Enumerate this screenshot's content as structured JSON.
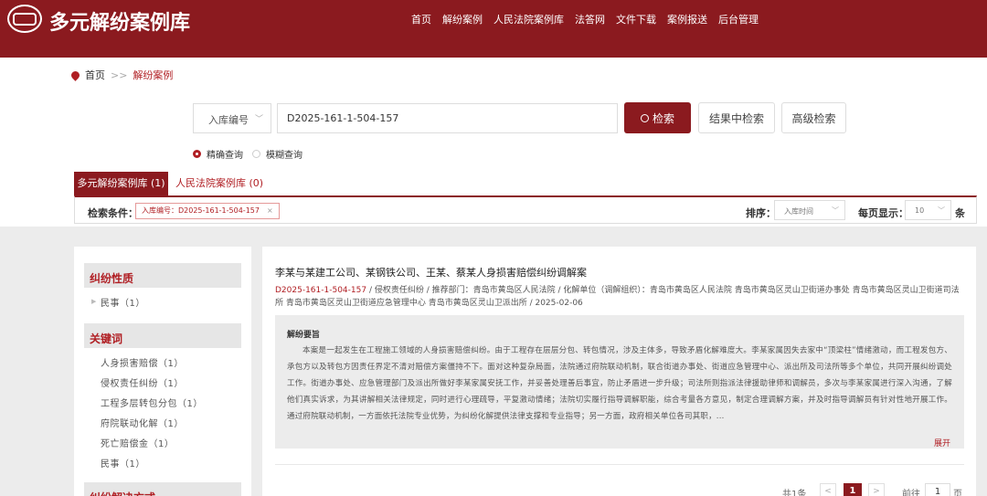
{
  "header": {
    "title": "多元解纷案例库",
    "nav": [
      "首页",
      "解纷案例",
      "人民法院案例库",
      "法答网",
      "文件下载",
      "案例报送",
      "后台管理"
    ]
  },
  "breadcrumb": {
    "home": "首页",
    "separator": ">>",
    "current": "解纷案例"
  },
  "search": {
    "field_label": "入库编号",
    "query": "D2025-161-1-504-157",
    "search_button": "检索",
    "within_button": "结果中检索",
    "advanced_button": "高级检索",
    "mode_exact": "精确查询",
    "mode_fuzzy": "模糊查询",
    "selected_mode": "exact"
  },
  "tabs": [
    {
      "label": "多元解纷案例库 (1)",
      "active": true
    },
    {
      "label": "人民法院案例库 (0)",
      "active": false
    }
  ],
  "conditions": {
    "label": "检索条件：",
    "tag": "入库编号：D2025-161-1-504-157",
    "tag_close": "×",
    "sort_label": "排序：",
    "sort_value": "入库时间",
    "per_page_label": "每页显示：",
    "per_page_value": "10",
    "per_page_unit": "条"
  },
  "sidebar": {
    "groups": [
      {
        "title": "纠纷性质",
        "items": [
          "民事（1）"
        ]
      },
      {
        "title": "关键词",
        "items": [
          "人身损害赔偿（1）",
          "侵权责任纠纷（1）",
          "工程多层转包分包（1）",
          "府院联动化解（1）",
          "死亡赔偿金（1）",
          "民事（1）"
        ]
      },
      {
        "title": "纠纷解决方式",
        "items": []
      }
    ]
  },
  "result": {
    "title": "李某与某建工公司、某钢铁公司、王某、蔡某人身损害赔偿纠纷调解案",
    "code": "D2025-161-1-504-157",
    "meta": " / 侵权责任纠纷 / 推荐部门：青岛市黄岛区人民法院 / 化解单位（调解组织）：青岛市黄岛区人民法院 青岛市黄岛区灵山卫街道办事处 青岛市黄岛区灵山卫街道司法所 青岛市黄岛区灵山卫街道应急管理中心 青岛市黄岛区灵山卫派出所 / 2025-02-06",
    "summary_heading": "解纷要旨",
    "summary": "本案是一起发生在工程施工领域的人身损害赔偿纠纷。由于工程存在层层分包、转包情况，涉及主体多，导致矛盾化解难度大。李某家属因失去家中“顶梁柱”情绪激动，而工程发包方、承包方以及转包方因责任界定不清对赔偿方案僵持不下。面对这种复杂局面，法院通过府院联动机制，联合街道办事处、街道应急管理中心、派出所及司法所等多个单位，共同开展纠纷调处工作。街道办事处、应急管理部门及派出所做好李某家属安抚工作，并妥善处理善后事宜，防止矛盾进一步升级；司法所则指派法律援助律师和调解员，多次与李某家属进行深入沟通，了解他们真实诉求，为其讲解相关法律规定，同时进行心理疏导，平复激动情绪；法院切实履行指导调解职能，综合考量各方意见，制定合理调解方案，并及时指导调解员有针对性地开展工作。通过府院联动机制，一方面依托法院专业优势，为纠纷化解提供法律支撑和专业指导；另一方面，政府相关单位各司其职，...",
    "expand": "展开"
  },
  "pagination": {
    "total": "共1条",
    "prev": "<",
    "current": "1",
    "next": ">",
    "goto_label": "前往",
    "goto_value": "1",
    "goto_unit": "页"
  }
}
